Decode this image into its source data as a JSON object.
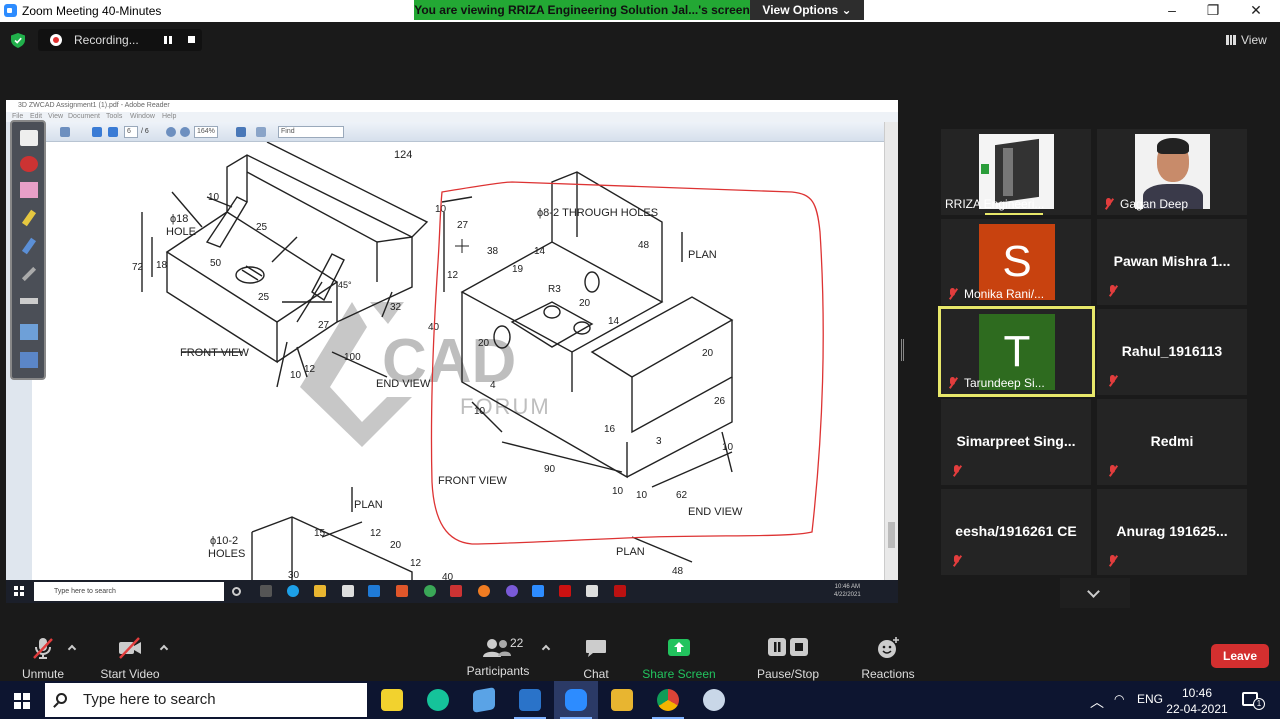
{
  "window": {
    "title": "Zoom Meeting 40-Minutes",
    "controls": [
      "–",
      "❐",
      "✕"
    ]
  },
  "banner": {
    "text": "You are viewing RRIZA Engineering Solution Jal...'s screen",
    "view_options": "View Options ⌄"
  },
  "recording": {
    "label": "Recording..."
  },
  "view_button": "View",
  "shared_screen": {
    "reader_title": "3D ZWCAD Assignment1 (1).pdf - Adobe Reader",
    "menu": [
      "File",
      "Edit",
      "View",
      "Document",
      "Tools",
      "Window",
      "Help"
    ],
    "page_current": "6",
    "page_total": "/ 6",
    "zoom": "164%",
    "find_placeholder": "Find",
    "drawing_labels": {
      "top_dim": "124",
      "hole18": "ϕ18",
      "hole_word": "HOLE",
      "front_view_left": "FRONT VIEW",
      "end_view_left": "END VIEW",
      "through_holes": "ϕ8-2 THROUGH HOLES",
      "plan_top": "PLAN",
      "front_view_right": "FRONT VIEW",
      "end_view_right": "END VIEW",
      "plan_bottom": "PLAN",
      "holes10": "ϕ10-2",
      "holes_word": "HOLES",
      "plan_bottom_right": "PLAN",
      "watermark_cad": "CAD",
      "watermark_forum": "FORUM",
      "dims": [
        "10",
        "27",
        "38",
        "25",
        "72",
        "18",
        "50",
        "25",
        "45°",
        "32",
        "27",
        "10",
        "12",
        "100",
        "40",
        "12",
        "19",
        "14",
        "48",
        "R3",
        "20",
        "14",
        "20",
        "4",
        "20",
        "26",
        "16",
        "3",
        "10",
        "90",
        "10",
        "10",
        "62",
        "10",
        "15",
        "12",
        "20",
        "30",
        "12",
        "40",
        "48"
      ]
    },
    "taskbar": {
      "search": "Type here to search",
      "time": "10:46 AM",
      "date": "4/22/2021"
    }
  },
  "participants": [
    {
      "name": "RRIZA Engineeri...",
      "type": "video",
      "muted": false
    },
    {
      "name": "Gagan Deep",
      "type": "photo",
      "muted": true
    },
    {
      "name": "Monika Rani/...",
      "type": "letter",
      "letter": "S",
      "color": "#c8420f",
      "muted": true
    },
    {
      "name": "Pawan Mishra 1...",
      "type": "name",
      "muted": true
    },
    {
      "name": "Tarundeep Si...",
      "type": "letter",
      "letter": "T",
      "color": "#2e6b1f",
      "muted": true,
      "active": true
    },
    {
      "name": "Rahul_1916113",
      "type": "name",
      "muted": true
    },
    {
      "name": "Simarpreet Sing...",
      "type": "name",
      "muted": true
    },
    {
      "name": "Redmi",
      "type": "name",
      "muted": true
    },
    {
      "name": "eesha/1916261 CE",
      "type": "name",
      "muted": true
    },
    {
      "name": "Anurag 191625...",
      "type": "name",
      "muted": true
    }
  ],
  "toolbar": {
    "unmute": "Unmute",
    "start_video": "Start Video",
    "participants": "Participants",
    "participants_count": "22",
    "chat": "Chat",
    "share_screen": "Share Screen",
    "pause_stop_recording": "Pause/Stop Recording",
    "reactions": "Reactions",
    "leave": "Leave"
  },
  "taskbar": {
    "search_placeholder": "Type here to search",
    "language": "ENG",
    "time": "10:46",
    "date": "22-04-2021",
    "notification_count": "1"
  },
  "colors": {
    "banner_green": "#23a834",
    "share_green": "#22c35e",
    "leave_red": "#d32f2f",
    "active_border": "#e8e86a",
    "annotation_red": "#d33"
  }
}
